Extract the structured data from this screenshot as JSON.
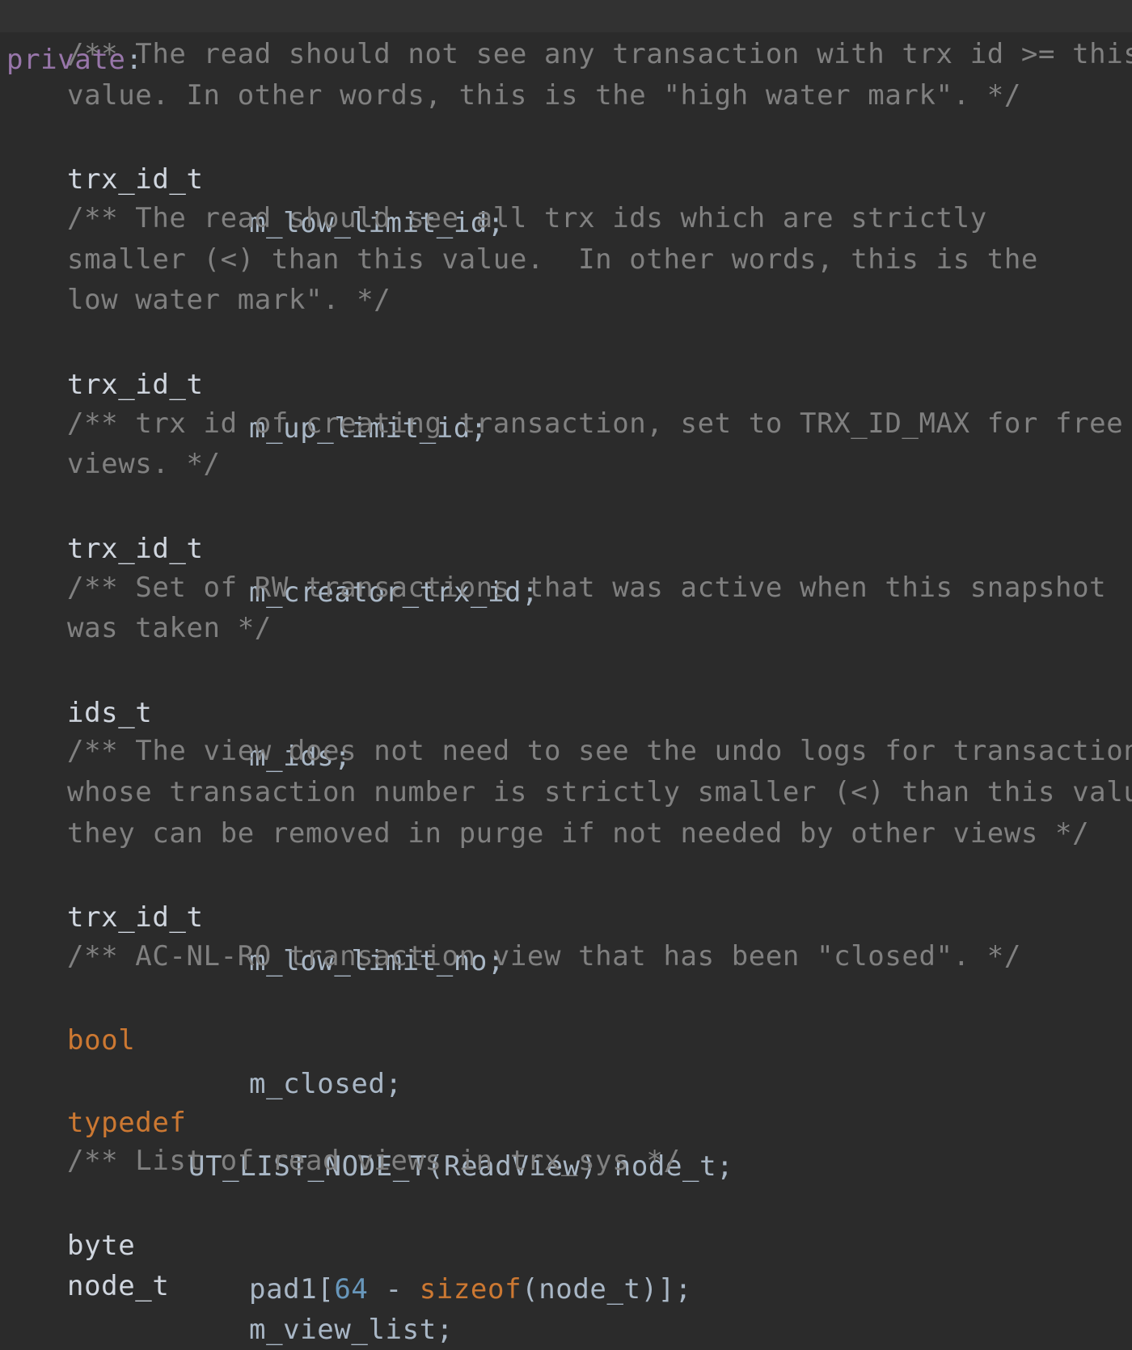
{
  "editor": {
    "access_specifier": "private",
    "colon": ":",
    "lines": {
      "c1a": "/** The read should not see any transaction with trx id >= this",
      "c1b": "value. In other words, this is the \"high water mark\". */",
      "d1_type": "trx_id_t",
      "d1_name": "m_low_limit_id;",
      "c2a": "/** The read should see all trx ids which are strictly",
      "c2b": "smaller (<) than this value.  In other words, this is the",
      "c2c": "low water mark\". */",
      "d2_type": "trx_id_t",
      "d2_name": "m_up_limit_id;",
      "c3a": "/** trx id of creating transaction, set to TRX_ID_MAX for free",
      "c3b": "views. */",
      "d3_type": "trx_id_t",
      "d3_name": "m_creator_trx_id;",
      "c4a": "/** Set of RW transactions that was active when this snapshot",
      "c4b": "was taken */",
      "d4_type": "ids_t",
      "d4_name": "m_ids;",
      "c5a": "/** The view does not need to see the undo logs for transactions",
      "c5b": "whose transaction number is strictly smaller (<) than this value:",
      "c5c": "they can be removed in purge if not needed by other views */",
      "d5_type": "trx_id_t",
      "d5_name": "m_low_limit_no;",
      "c6a": "/** AC-NL-RO transaction view that has been \"closed\". */",
      "d6_type": "bool",
      "d6_name": "m_closed;",
      "td_keyword": "typedef",
      "td_rest": "UT_LIST_NODE_T(ReadView) node_t;",
      "c7a": "/** List of read views in trx_sys */",
      "d7_type": "byte",
      "d7_name_a": "pad1[",
      "d7_num": "64",
      "d7_minus": " - ",
      "d7_sizeof": "sizeof",
      "d7_name_b": "(node_t)];",
      "d8_type": "node_t",
      "d8_name": "m_view_list;"
    }
  }
}
